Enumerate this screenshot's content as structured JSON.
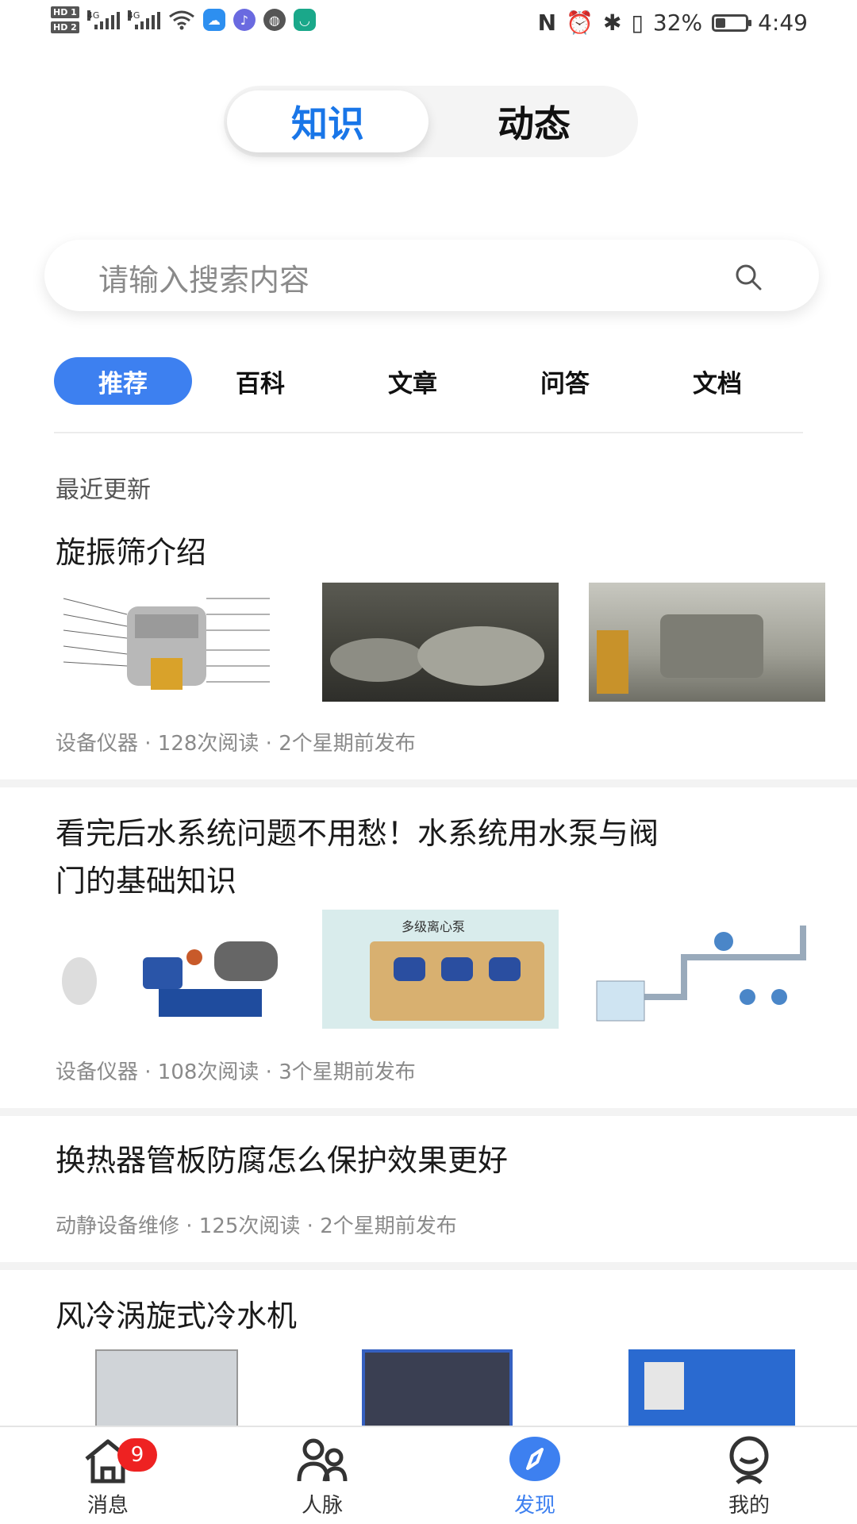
{
  "status_bar": {
    "hd1": "HD 1",
    "hd2": "HD 2",
    "net1": "4G",
    "net2": "4G",
    "battery": "32%",
    "time": "4:49",
    "battery_level": 0.32
  },
  "segment": {
    "active": "知识",
    "other": "动态",
    "accent": "#1976e8"
  },
  "search": {
    "placeholder": "请输入搜索内容"
  },
  "categories": [
    "推荐",
    "百科",
    "文章",
    "问答",
    "文档"
  ],
  "section_title": "最近更新",
  "articles": [
    {
      "title": "旋振筛介绍",
      "meta": "设备仪器 · 128次阅读 · 2个星期前发布"
    },
    {
      "title_line1": "看完后水系统问题不用愁！水系统用水泵与阀",
      "title_line2": "门的基础知识",
      "meta": "设备仪器 · 108次阅读 · 3个星期前发布",
      "thumb_caption": "多级离心泵"
    },
    {
      "title": "换热器管板防腐怎么保护效果更好",
      "meta": "动静设备维修 · 125次阅读 · 2个星期前发布"
    },
    {
      "title": "风冷涡旋式冷水机"
    }
  ],
  "bottom_nav": {
    "items": [
      "消息",
      "人脉",
      "发现",
      "我的"
    ],
    "badge": "9",
    "active_color": "#3d80f0"
  }
}
